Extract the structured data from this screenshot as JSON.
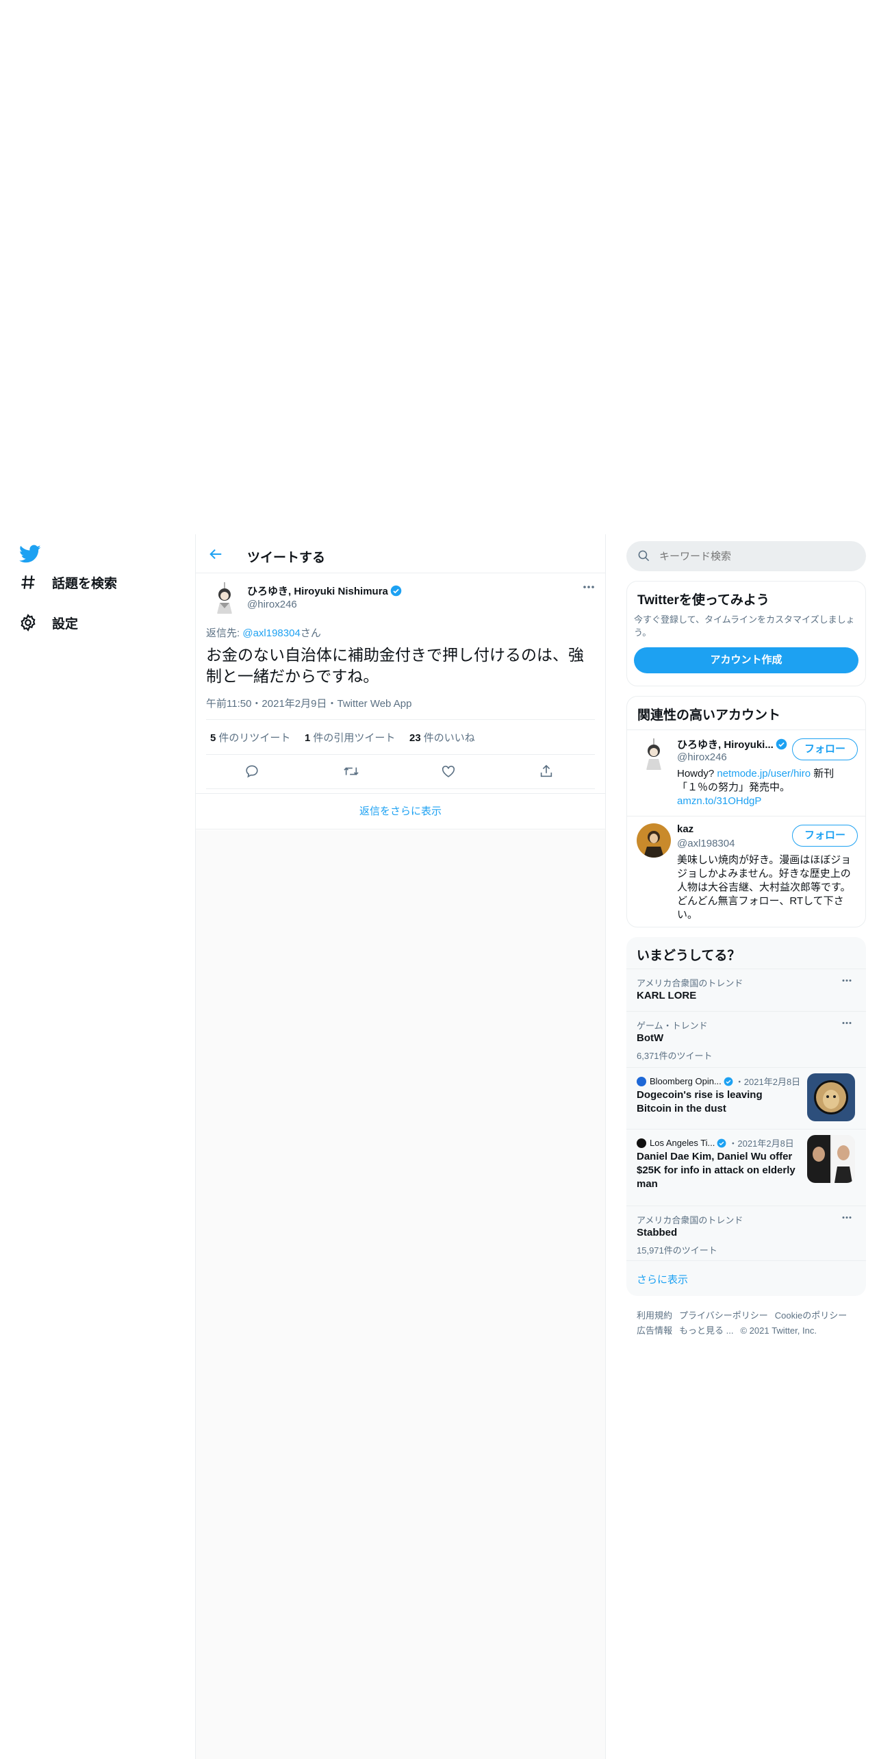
{
  "nav": {
    "items": [
      {
        "label": "話題を検索",
        "icon": "hashtag-icon"
      },
      {
        "label": "設定",
        "icon": "gear-icon"
      }
    ]
  },
  "header": {
    "title": "ツイートする"
  },
  "tweet": {
    "author_name": "ひろゆき, Hiroyuki Nishimura",
    "author_handle": "@hirox246",
    "reply_prefix": "返信先: ",
    "reply_handle": "@axl198304",
    "reply_suffix": "さん",
    "text": "お金のない自治体に補助金付きで押し付けるのは、強制と一緒だからですね。",
    "meta": "午前11:50・2021年2月9日・Twitter Web App",
    "stats": [
      {
        "count": "5",
        "label": "件のリツイート"
      },
      {
        "count": "1",
        "label": "件の引用ツイート"
      },
      {
        "count": "23",
        "label": "件のいいね"
      }
    ],
    "more_replies": "返信をさらに表示"
  },
  "search": {
    "placeholder": "キーワード検索"
  },
  "signup": {
    "title": "Twitterを使ってみよう",
    "desc": "今すぐ登録して、タイムラインをカスタマイズしましょう。",
    "button": "アカウント作成"
  },
  "related": {
    "title": "関連性の高いアカウント",
    "accounts": [
      {
        "name": "ひろゆき, Hiroyuki...",
        "handle": "@hirox246",
        "follow": "フォロー",
        "bio_prefix": "Howdy? ",
        "bio_link1": "netmode.jp/user/hiro",
        "bio_mid": " 新刊「１％の努力」発売中。",
        "bio_link2": "amzn.to/31OHdgP"
      },
      {
        "name": "kaz",
        "handle": "@axl198304",
        "follow": "フォロー",
        "bio": "美味しい焼肉が好き。漫画はほぼジョジョしかよみません。好きな歴史上の人物は大谷吉継、大村益次郎等です。どんどん無言フォロー、RTして下さい。"
      }
    ]
  },
  "trends": {
    "title": "いまどうしてる？",
    "items": [
      {
        "context": "アメリカ合衆国のトレンド",
        "name": "KARL LORE"
      },
      {
        "context": "ゲーム・トレンド",
        "name": "BotW",
        "count": "6,371件のツイート"
      },
      {
        "source": "Bloomberg Opin...",
        "date": "2021年2月8日",
        "headline": "Dogecoin's rise is leaving Bitcoin in the dust"
      },
      {
        "source": "Los Angeles Ti...",
        "date": "2021年2月8日",
        "headline": "Daniel Dae Kim, Daniel Wu offer $25K for info in attack on elderly man"
      },
      {
        "context": "アメリカ合衆国のトレンド",
        "name": "Stabbed",
        "count": "15,971件のツイート"
      }
    ],
    "show_more": "さらに表示"
  },
  "footer": {
    "links": [
      "利用規約",
      "プライバシーポリシー",
      "Cookieのポリシー",
      "広告情報",
      "もっと見る ..."
    ],
    "copyright": "© 2021 Twitter, Inc."
  },
  "colors": {
    "accent": "#1da1f2",
    "text": "#0f1419",
    "secondary": "#5b7083",
    "border": "#ebeef0"
  }
}
